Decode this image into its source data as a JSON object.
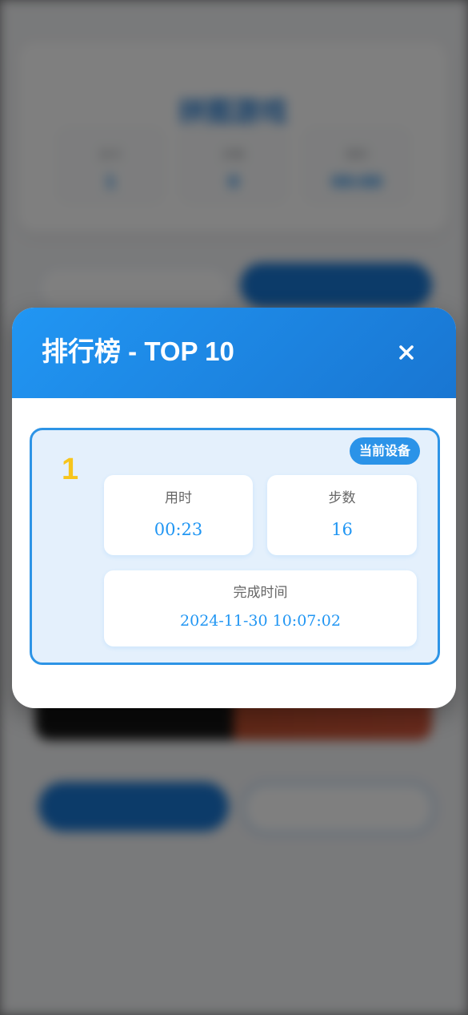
{
  "background": {
    "title": "拼图游戏",
    "stats": [
      {
        "label": "关卡",
        "value": "1"
      },
      {
        "label": "步数",
        "value": "0"
      },
      {
        "label": "用时",
        "value": "00:00"
      }
    ]
  },
  "modal": {
    "title": "排行榜 - TOP 10",
    "close_icon": "close-icon",
    "entries": [
      {
        "rank": "1",
        "badge": "当前设备",
        "time_label": "用时",
        "time_value": "00:23",
        "steps_label": "步数",
        "steps_value": "16",
        "completed_label": "完成时间",
        "completed_value": "2024-11-30 10:07:02"
      }
    ]
  },
  "colors": {
    "header_gradient_start": "#2196f3",
    "header_gradient_end": "#1976d2",
    "accent": "#2196f3",
    "rank_gold": "#f7c51c",
    "entry_background": "#e4f0fc",
    "overlay": "rgba(0,0,0,0.5)"
  }
}
